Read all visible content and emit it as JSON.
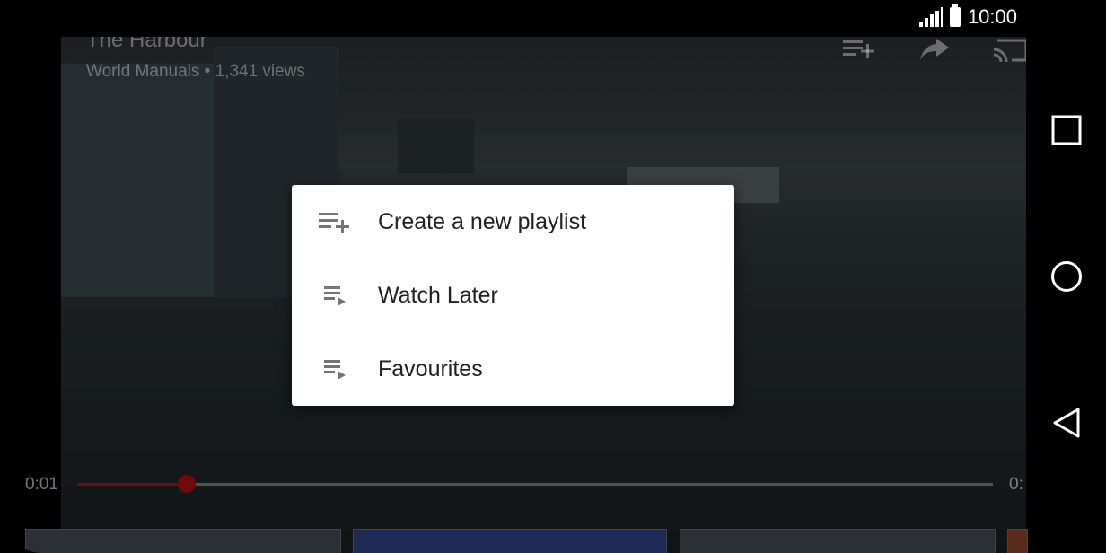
{
  "status_bar": {
    "time": "10:00"
  },
  "video": {
    "title": "The Harbour",
    "channel": "World Manuals",
    "views": "1,341 views",
    "meta_separator": " • ",
    "current_time": "0:01",
    "duration_partial": "0:",
    "progress_fraction": 0.12
  },
  "dialog": {
    "items": [
      {
        "label": "Create a new playlist",
        "icon": "playlist-add-icon"
      },
      {
        "label": "Watch Later",
        "icon": "playlist-play-icon"
      },
      {
        "label": "Favourites",
        "icon": "playlist-play-icon"
      }
    ]
  },
  "colors": {
    "accent": "#cc0000",
    "dialog_bg": "#ffffff",
    "text": "#212121",
    "icon": "#757575"
  }
}
